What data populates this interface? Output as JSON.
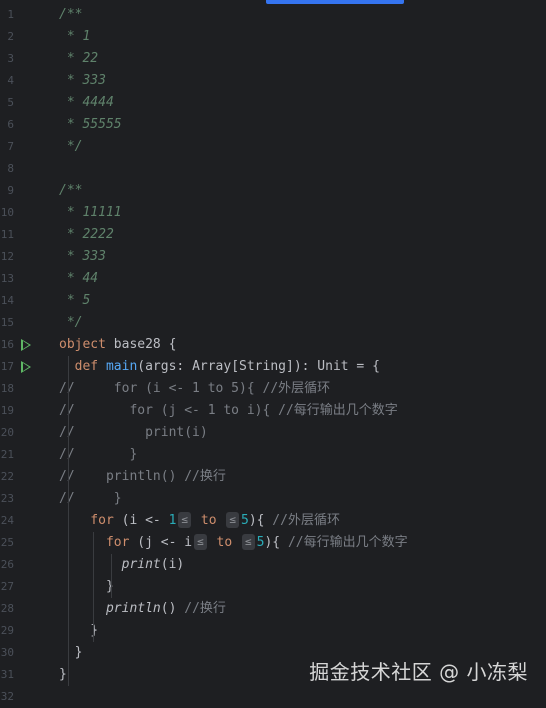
{
  "watermark": "掘金技术社区 @ 小冻梨",
  "lines": [
    {
      "n": "1",
      "indent": 0,
      "tokens": [
        {
          "t": "/**",
          "c": "doc"
        }
      ]
    },
    {
      "n": "2",
      "indent": 0,
      "tokens": [
        {
          "t": " * 1",
          "c": "doc"
        }
      ]
    },
    {
      "n": "3",
      "indent": 0,
      "tokens": [
        {
          "t": " * 22",
          "c": "doc"
        }
      ]
    },
    {
      "n": "4",
      "indent": 0,
      "tokens": [
        {
          "t": " * 333",
          "c": "doc"
        }
      ]
    },
    {
      "n": "5",
      "indent": 0,
      "tokens": [
        {
          "t": " * 4444",
          "c": "doc"
        }
      ]
    },
    {
      "n": "6",
      "indent": 0,
      "tokens": [
        {
          "t": " * 55555",
          "c": "doc"
        }
      ]
    },
    {
      "n": "7",
      "indent": 0,
      "tokens": [
        {
          "t": " */",
          "c": "doc"
        }
      ]
    },
    {
      "n": "8",
      "indent": 0,
      "tokens": []
    },
    {
      "n": "9",
      "indent": 0,
      "tokens": [
        {
          "t": "/**",
          "c": "doc"
        }
      ]
    },
    {
      "n": "10",
      "indent": 0,
      "tokens": [
        {
          "t": " * 11111",
          "c": "doc"
        }
      ]
    },
    {
      "n": "11",
      "indent": 0,
      "tokens": [
        {
          "t": " * 2222",
          "c": "doc"
        }
      ]
    },
    {
      "n": "12",
      "indent": 0,
      "tokens": [
        {
          "t": " * 333",
          "c": "doc"
        }
      ]
    },
    {
      "n": "13",
      "indent": 0,
      "tokens": [
        {
          "t": " * 44",
          "c": "doc"
        }
      ]
    },
    {
      "n": "14",
      "indent": 0,
      "tokens": [
        {
          "t": " * 5",
          "c": "doc"
        }
      ]
    },
    {
      "n": "15",
      "indent": 0,
      "tokens": [
        {
          "t": " */",
          "c": "doc"
        }
      ]
    },
    {
      "n": "16",
      "indent": 0,
      "run": true,
      "tokens": [
        {
          "t": "object",
          "c": "kw"
        },
        {
          "t": " base28 {",
          "c": "plain"
        }
      ]
    },
    {
      "n": "17",
      "indent": 0,
      "run": true,
      "tokens": [
        {
          "t": "  def ",
          "c": "kw"
        },
        {
          "t": "main",
          "c": "fn"
        },
        {
          "t": "(args: Array[String]): Unit = {",
          "c": "plain"
        }
      ]
    },
    {
      "n": "18",
      "indent": 0,
      "tokens": [
        {
          "t": "//     for (i <- 1 to 5){ //外层循环",
          "c": "cmt"
        }
      ]
    },
    {
      "n": "19",
      "indent": 0,
      "tokens": [
        {
          "t": "//       for (j <- 1 to i){ //每行输出几个数字",
          "c": "cmt"
        }
      ]
    },
    {
      "n": "20",
      "indent": 0,
      "tokens": [
        {
          "t": "//         print(i)",
          "c": "cmt"
        }
      ]
    },
    {
      "n": "21",
      "indent": 0,
      "tokens": [
        {
          "t": "//       }",
          "c": "cmt"
        }
      ]
    },
    {
      "n": "22",
      "indent": 0,
      "tokens": [
        {
          "t": "//    println() //换行",
          "c": "cmt"
        }
      ]
    },
    {
      "n": "23",
      "indent": 0,
      "tokens": [
        {
          "t": "//     }",
          "c": "cmt"
        }
      ]
    },
    {
      "n": "24",
      "indent": 0,
      "tokens": [
        {
          "t": "    for",
          "c": "kw"
        },
        {
          "t": " (i <- ",
          "c": "plain"
        },
        {
          "t": "1",
          "c": "num"
        },
        {
          "t": "≤",
          "c": "hint"
        },
        {
          "t": " to ",
          "c": "kw"
        },
        {
          "t": "≤",
          "c": "hint"
        },
        {
          "t": "5",
          "c": "num"
        },
        {
          "t": "){ ",
          "c": "plain"
        },
        {
          "t": "//外层循环",
          "c": "cmt"
        }
      ]
    },
    {
      "n": "25",
      "indent": 0,
      "tokens": [
        {
          "t": "      for",
          "c": "kw"
        },
        {
          "t": " (j <- i",
          "c": "plain"
        },
        {
          "t": "≤",
          "c": "hint"
        },
        {
          "t": " to ",
          "c": "kw"
        },
        {
          "t": "≤",
          "c": "hint"
        },
        {
          "t": "5",
          "c": "num"
        },
        {
          "t": "){ ",
          "c": "plain"
        },
        {
          "t": "//每行输出几个数字",
          "c": "cmt"
        }
      ]
    },
    {
      "n": "26",
      "indent": 0,
      "tokens": [
        {
          "t": "        ",
          "c": "plain"
        },
        {
          "t": "print",
          "c": "plain ital"
        },
        {
          "t": "(i)",
          "c": "plain"
        }
      ]
    },
    {
      "n": "27",
      "indent": 0,
      "tokens": [
        {
          "t": "      }",
          "c": "plain"
        }
      ]
    },
    {
      "n": "28",
      "indent": 0,
      "tokens": [
        {
          "t": "      ",
          "c": "plain"
        },
        {
          "t": "println",
          "c": "plain ital"
        },
        {
          "t": "() ",
          "c": "plain"
        },
        {
          "t": "//换行",
          "c": "cmt"
        }
      ]
    },
    {
      "n": "29",
      "indent": 0,
      "tokens": [
        {
          "t": "    }",
          "c": "plain"
        }
      ]
    },
    {
      "n": "30",
      "indent": 0,
      "tokens": [
        {
          "t": "  }",
          "c": "plain"
        }
      ]
    },
    {
      "n": "31",
      "indent": 0,
      "tokens": [
        {
          "t": "}",
          "c": "plain"
        }
      ]
    },
    {
      "n": "32",
      "indent": 0,
      "tokens": []
    }
  ]
}
